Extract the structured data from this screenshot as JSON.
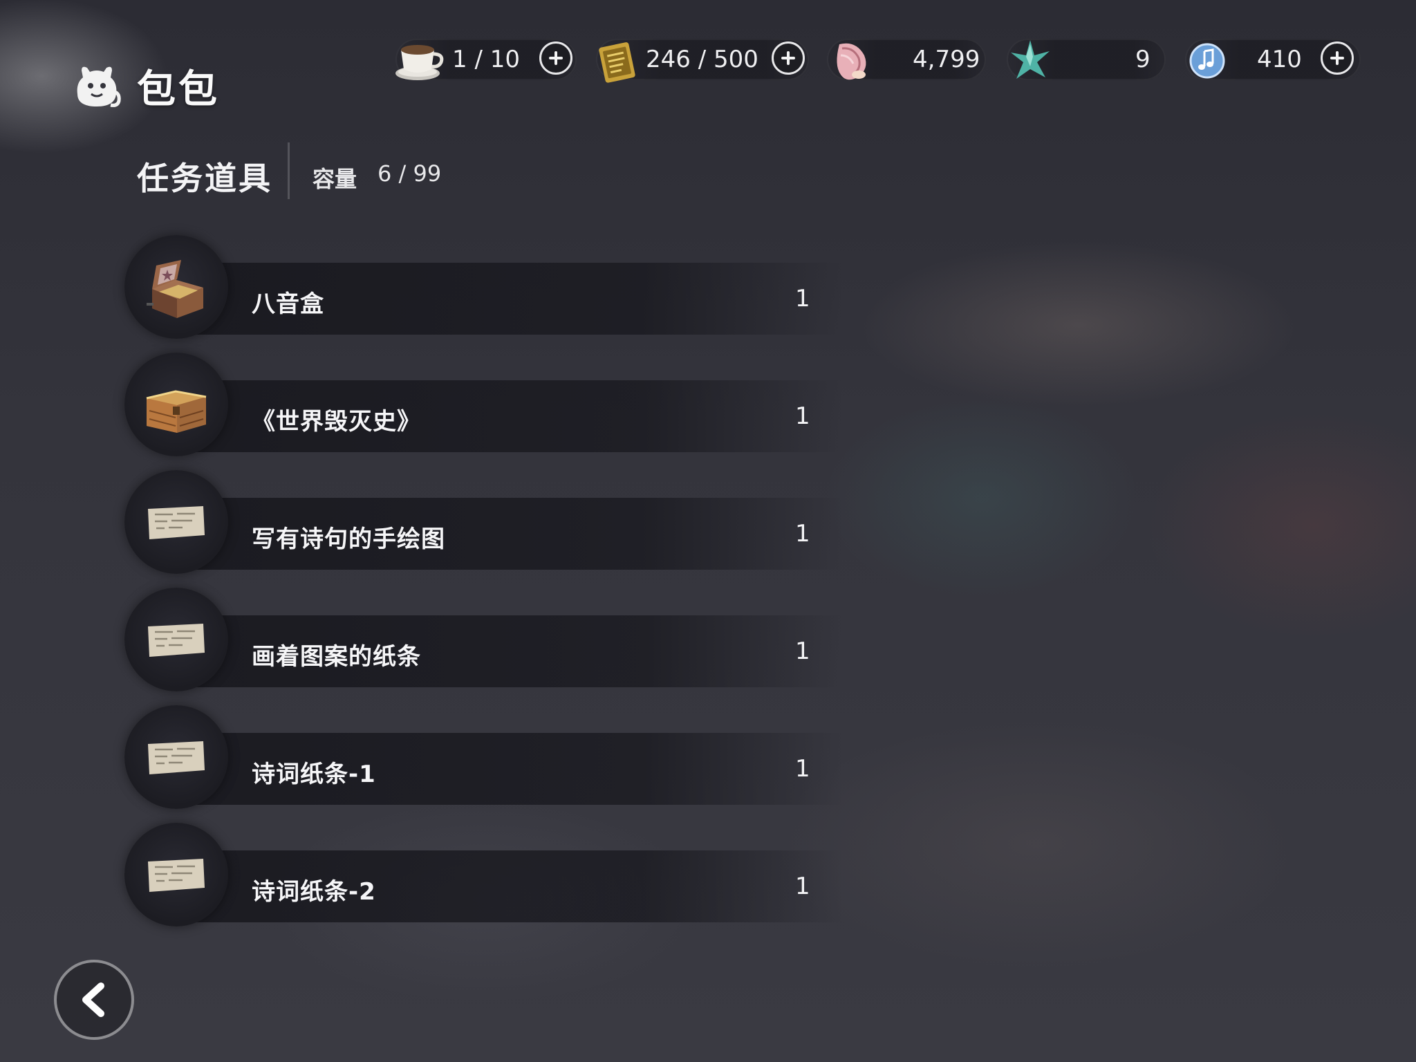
{
  "header": {
    "title": "包包",
    "resources": [
      {
        "name": "coffee",
        "icon": "coffee-cup-icon",
        "value": "1 / 10",
        "has_plus": true
      },
      {
        "name": "ticket",
        "icon": "golden-ticket-icon",
        "value": "246 / 500",
        "has_plus": true
      },
      {
        "name": "shell",
        "icon": "conch-shell-icon",
        "value": "4,799",
        "has_plus": false
      },
      {
        "name": "star",
        "icon": "teal-star-icon",
        "value": "9",
        "has_plus": false
      },
      {
        "name": "note",
        "icon": "music-note-orb-icon",
        "value": "410",
        "has_plus": true
      }
    ]
  },
  "section": {
    "title": "任务道具",
    "capacity_label": "容量",
    "capacity_value": "6 / 99"
  },
  "items": [
    {
      "name": "八音盒",
      "qty": "1",
      "icon": "music-box-icon"
    },
    {
      "name": "《世界毁灭史》",
      "qty": "1",
      "icon": "wooden-chest-icon"
    },
    {
      "name": "写有诗句的手绘图",
      "qty": "1",
      "icon": "paper-note-icon"
    },
    {
      "name": "画着图案的纸条",
      "qty": "1",
      "icon": "paper-note-icon"
    },
    {
      "name": "诗词纸条-1",
      "qty": "1",
      "icon": "paper-note-icon"
    },
    {
      "name": "诗词纸条-2",
      "qty": "1",
      "icon": "paper-note-icon"
    }
  ],
  "colors": {
    "background": "#34343c",
    "row_bar": "#18181e",
    "text": "#f4f4f6"
  }
}
